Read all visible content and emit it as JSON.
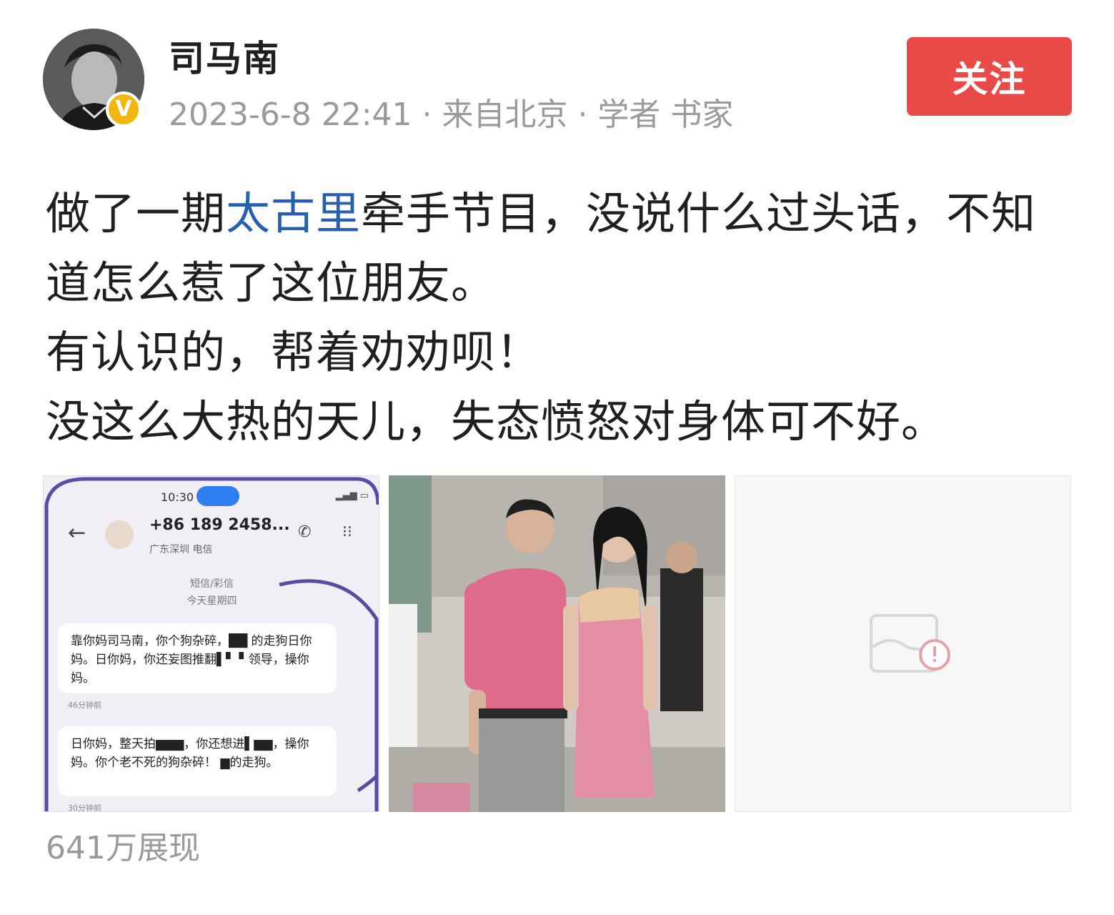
{
  "profile": {
    "username": "司马南",
    "meta": "2023-6-8 22:41 · 来自北京 · 学者 书家",
    "verified_badge": "V",
    "follow_label": "关注"
  },
  "post": {
    "line1_a": "做了一期",
    "line1_link": "太古里",
    "line1_b": "牵手节目，没说什么过头话，不知道怎么惹了这位朋友。",
    "line2": "有认识的，帮着劝劝呗！",
    "line3": "没这么大热的天儿，失态愤怒对身体可不好。"
  },
  "images": {
    "sms_screenshot": {
      "time": "10:30",
      "number": "+86 189 2458...",
      "location": "广东深圳 电信",
      "sms_label": "短信/彩信",
      "date_label": "今天星期四",
      "msg1": "靠你妈司马南，你个狗杂碎，██ 的走狗日你妈。日你妈，你还妄图推翻▌▘ ▘领导，操你妈。",
      "msg1_ago": "46分钟前",
      "msg2": "日你妈，整天拍▆▆▆，你还想进▌▆▆，操你妈。你个老不死的狗杂碎！ ▆的走狗。",
      "msg2_ago": "30分钟前"
    },
    "broken_image_icon": "broken-image-icon"
  },
  "footer": {
    "views": "641万展现"
  },
  "colors": {
    "follow_bg": "#e94a47",
    "link": "#2660b0",
    "meta_gray": "#9a9a9a",
    "badge": "#f2b70f"
  }
}
